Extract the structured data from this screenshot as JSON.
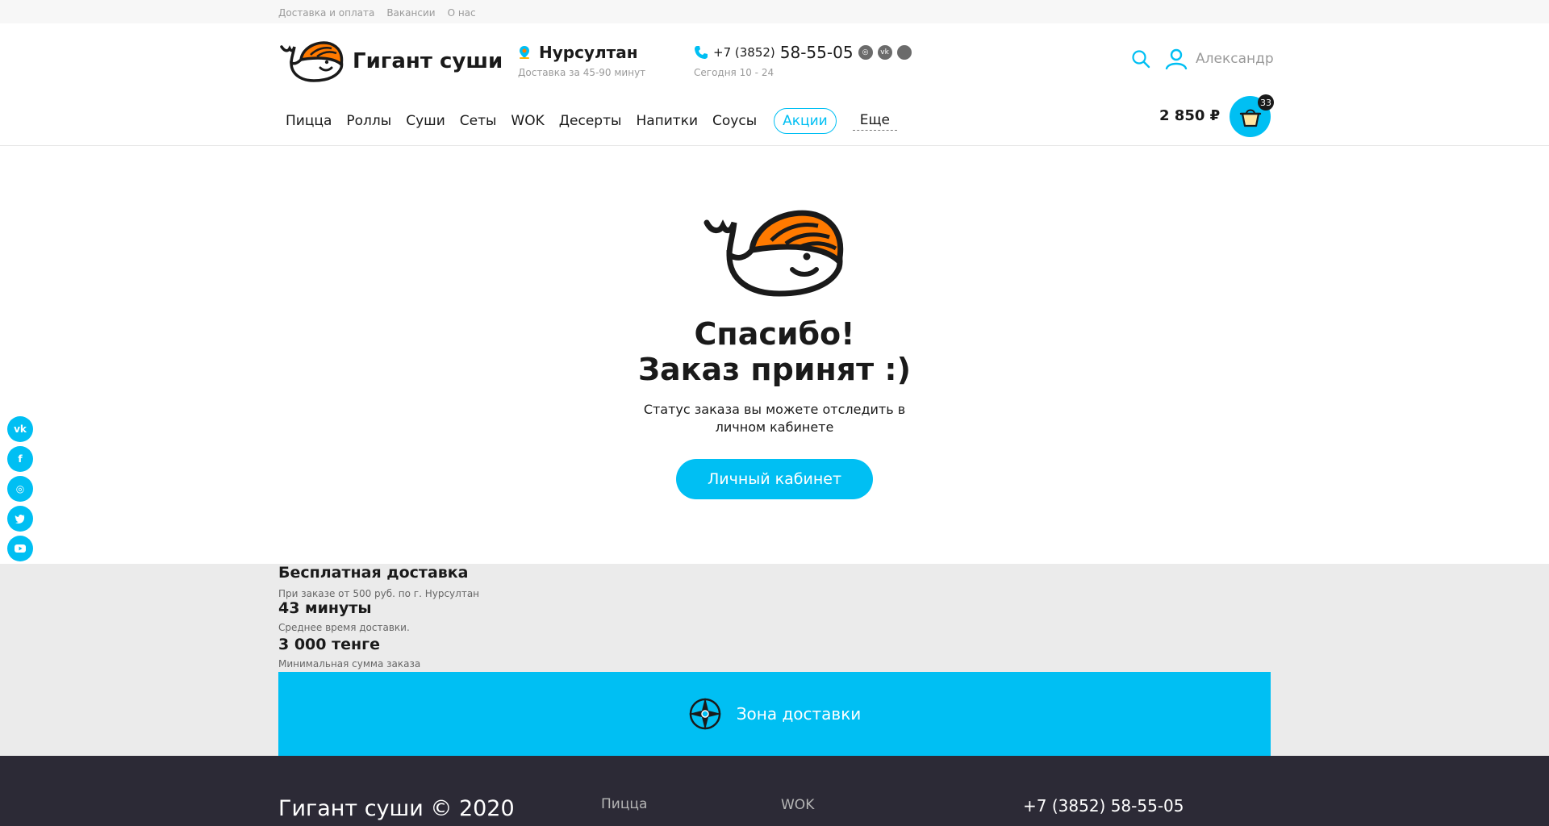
{
  "topbar": {
    "links": [
      "Доставка и оплата",
      "Вакансии",
      "О нас"
    ]
  },
  "header": {
    "logo_text": "Гигант суши",
    "city": "Нурсултан",
    "city_sub": "Доставка за 45-90 минут",
    "phone_code": "+7 (3852)",
    "phone_number": "58-55-05",
    "phone_sub": "Сегодня 10 - 24",
    "user_name": "Александр"
  },
  "nav": {
    "items": [
      "Пицца",
      "Роллы",
      "Суши",
      "Сеты",
      "WOK",
      "Десерты",
      "Напитки",
      "Соусы"
    ],
    "promo": "Акции",
    "more": "Еще"
  },
  "cart": {
    "sum": "2 850 ₽",
    "count": "33"
  },
  "success": {
    "title_line1": "Спасибо!",
    "title_line2": "Заказ принят :)",
    "text": "Статус заказа вы можете отследить в личном кабинете",
    "button": "Личный кабинет"
  },
  "info": {
    "delivery_title": "Бесплатная доставка",
    "delivery_sub": "При заказе от 500 руб. по г. Нурсултан",
    "time_title": "43 минуты",
    "time_sub": "Среднее время доставки.",
    "min_title": "3 000 тенге",
    "min_sub": "Минимальная сумма заказа",
    "zone_label": "Зона доставки"
  },
  "footer": {
    "copyright": "Гигант суши © 2020",
    "link1": "Пицца",
    "link2": "WOK",
    "phone": "+7 (3852) 58-55-05"
  },
  "colors": {
    "accent": "#00bff3",
    "salmon": "#ff7a00",
    "footer_bg": "#2c2a36",
    "info_bg": "#ebebeb"
  },
  "icons": [
    "location-pin-icon",
    "phone-icon",
    "instagram-icon",
    "vk-icon",
    "search-icon",
    "user-icon",
    "basket-icon",
    "compass-icon",
    "facebook-icon",
    "twitter-icon",
    "youtube-icon"
  ]
}
